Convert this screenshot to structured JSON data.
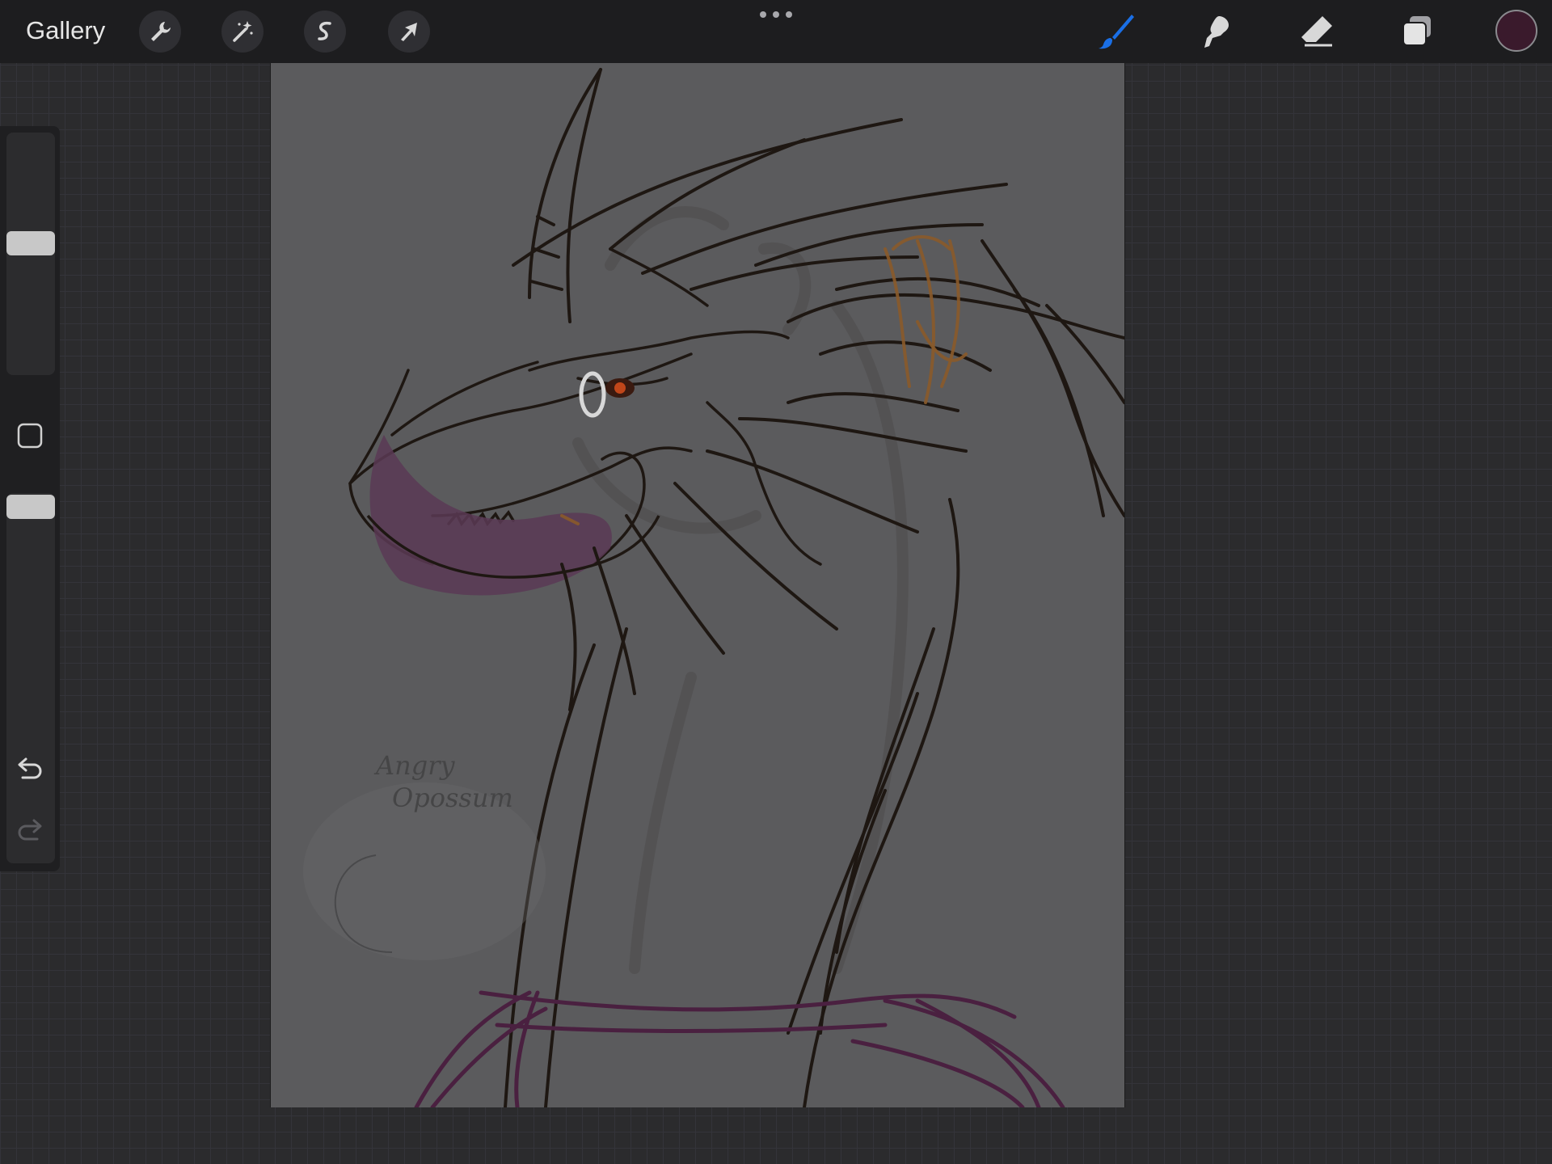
{
  "app": {
    "gallery_label": "Gallery"
  },
  "toolbar": {
    "left_tools": [
      {
        "name": "actions",
        "icon": "wrench-icon"
      },
      {
        "name": "adjustments",
        "icon": "magic-wand-icon"
      },
      {
        "name": "selection",
        "icon": "selection-s-icon"
      },
      {
        "name": "transform",
        "icon": "arrow-cursor-icon"
      }
    ],
    "right_tools": [
      {
        "name": "brush",
        "icon": "brush-icon",
        "active": true
      },
      {
        "name": "smudge",
        "icon": "smudge-icon",
        "active": false
      },
      {
        "name": "eraser",
        "icon": "eraser-icon",
        "active": false
      },
      {
        "name": "layers",
        "icon": "layers-icon",
        "active": false
      }
    ],
    "more_icon": "more-dots-icon",
    "current_color": "#3a1a2c",
    "accent_color": "#1a6fe6"
  },
  "sidebar": {
    "brush_size_level": 0.55,
    "opacity_level": 1.0,
    "modify_icon": "square-icon",
    "undo_icon": "undo-icon",
    "redo_icon": "redo-icon"
  },
  "canvas": {
    "background_color": "#5b5b5d",
    "watermark_text": [
      "Angry",
      "Opossum"
    ]
  }
}
